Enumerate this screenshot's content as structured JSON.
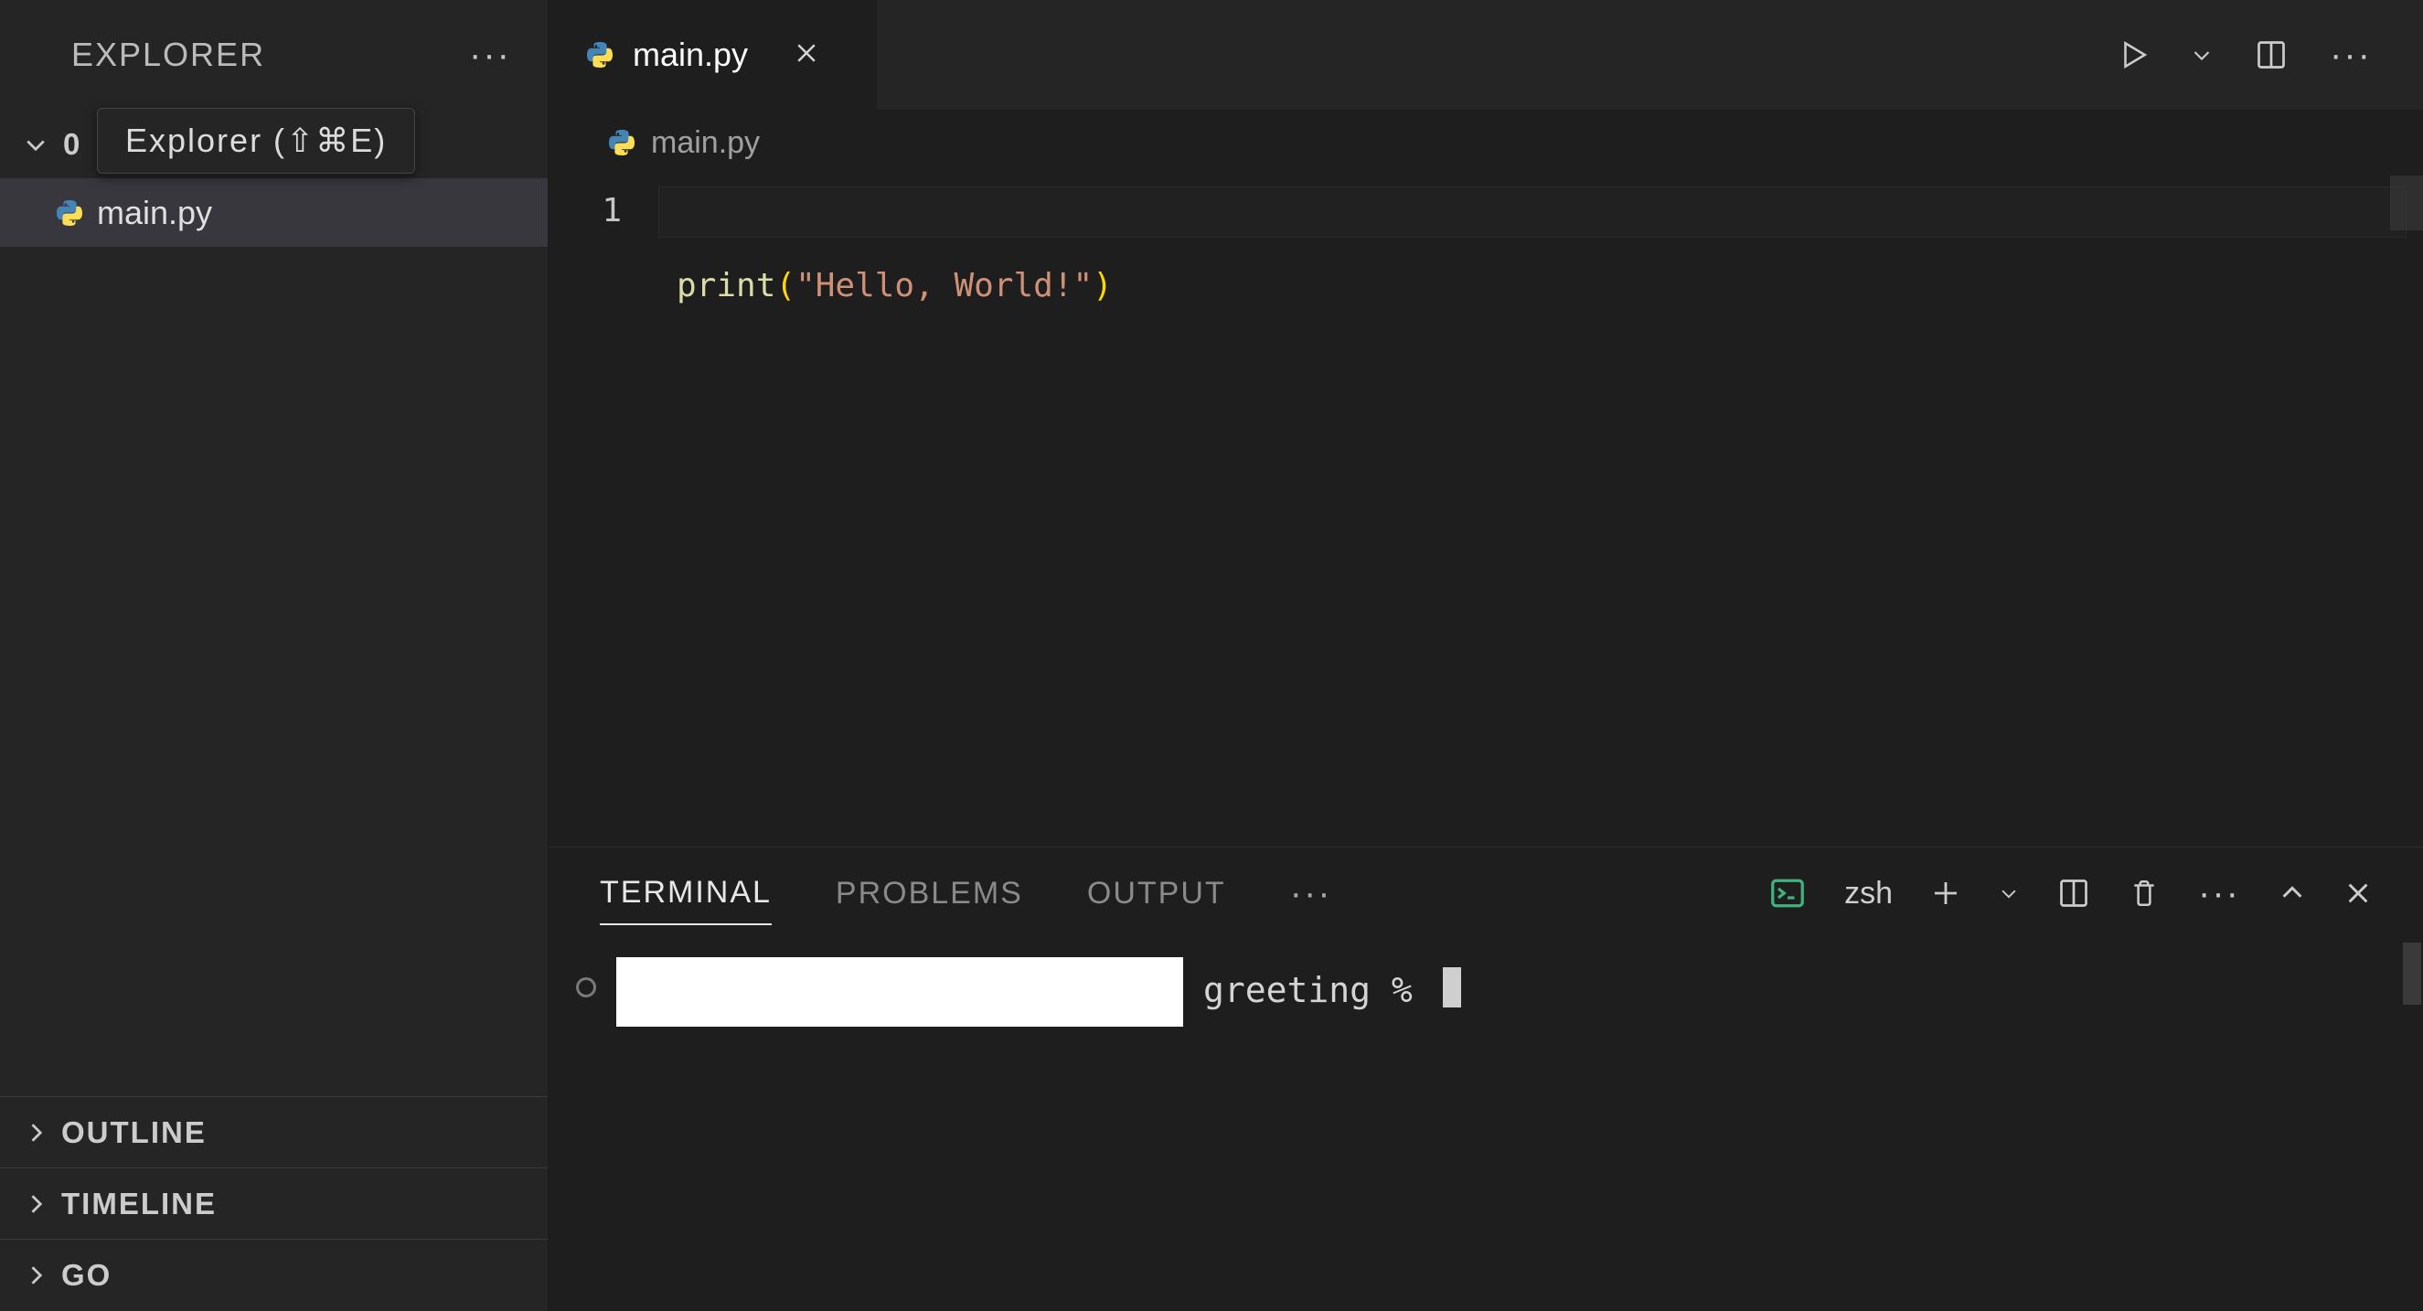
{
  "sidebar": {
    "title": "EXPLORER",
    "tooltip": "Explorer (⇧⌘E)",
    "folder_prefix": "0",
    "file_label": "main.py",
    "sections": [
      "OUTLINE",
      "TIMELINE",
      "GO"
    ]
  },
  "tab": {
    "label": "main.py"
  },
  "breadcrumb": {
    "file": "main.py"
  },
  "editor": {
    "line_number": "1",
    "tok_fn": "print",
    "tok_open": "(",
    "tok_str": "\"Hello, World!\"",
    "tok_close": ")"
  },
  "panel": {
    "tabs": {
      "terminal": "TERMINAL",
      "problems": "PROBLEMS",
      "output": "OUTPUT"
    },
    "shell": "zsh",
    "prompt_suffix": "greeting % "
  }
}
